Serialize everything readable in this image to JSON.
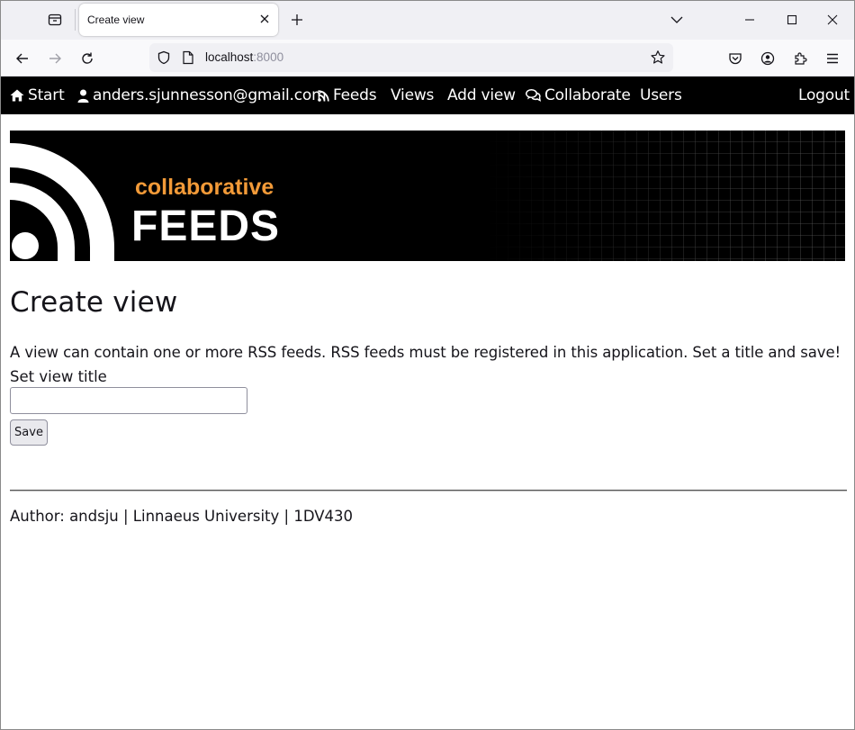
{
  "browser": {
    "tab_title": "Create view",
    "url_host": "localhost",
    "url_port": ":8000"
  },
  "sitenav": {
    "start": "Start",
    "user_email": "anders.sjunnesson@gmail.com",
    "feeds": "Feeds",
    "views": "Views",
    "add_view": "Add view",
    "collaborate": "Collaborate",
    "users": "Users",
    "logout": "Logout"
  },
  "banner": {
    "subtitle": "collaborative",
    "title": "FEEDS",
    "accent_color": "#f29a38"
  },
  "main": {
    "heading": "Create view",
    "description": "A view can contain one or more RSS feeds. RSS feeds must be registered in this application. Set a title and save!",
    "field_label": "Set view title",
    "field_value": "",
    "save_label": "Save"
  },
  "footer": {
    "text": "Author: andsju | Linnaeus University | 1DV430"
  },
  "icons": {
    "start": "home-icon",
    "user": "user-icon",
    "feeds": "rss-icon",
    "collaborate": "chat-icon"
  }
}
